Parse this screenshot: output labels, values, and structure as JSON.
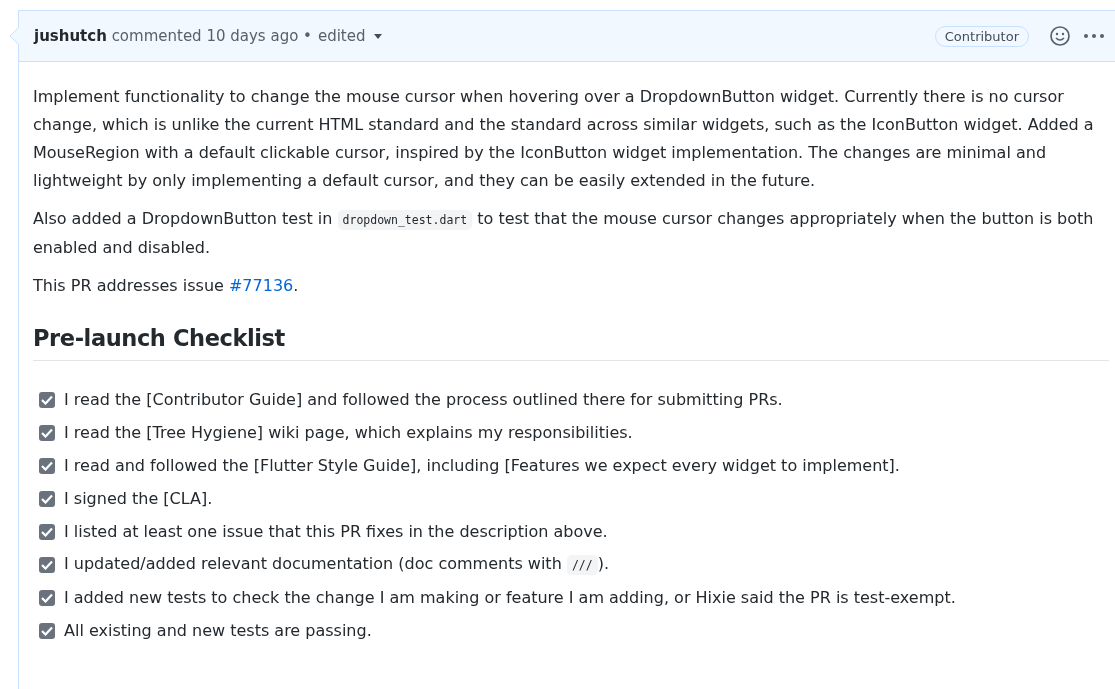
{
  "comment": {
    "author": "jushutch",
    "action": "commented",
    "time": "10 days ago",
    "separator": "•",
    "edited": "edited",
    "badge": "Contributor"
  },
  "paragraphs": [
    [
      {
        "kind": "text",
        "text": "Implement functionality to change the mouse cursor when hovering over a DropdownButton widget. Currently there is no cursor change, which is unlike the current HTML standard and the standard across similar widgets, such as the IconButton widget. Added a MouseRegion with a default clickable cursor, inspired by the IconButton widget implementation. The changes are minimal and lightweight by only implementing a default cursor, and they can be easily extended in the future."
      }
    ],
    [
      {
        "kind": "text",
        "text": "Also added a DropdownButton test in "
      },
      {
        "kind": "code",
        "text": "dropdown_test.dart"
      },
      {
        "kind": "text",
        "text": " to test that the mouse cursor changes appropriately when the button is both enabled and disabled."
      }
    ],
    [
      {
        "kind": "text",
        "text": "This PR addresses issue "
      },
      {
        "kind": "link",
        "text": "#77136"
      },
      {
        "kind": "text",
        "text": "."
      }
    ]
  ],
  "heading": "Pre-launch Checklist",
  "checklist": [
    {
      "checked": true,
      "parts": [
        {
          "kind": "text",
          "text": "I read the [Contributor Guide] and followed the process outlined there for submitting PRs."
        }
      ]
    },
    {
      "checked": true,
      "parts": [
        {
          "kind": "text",
          "text": "I read the [Tree Hygiene] wiki page, which explains my responsibilities."
        }
      ]
    },
    {
      "checked": true,
      "parts": [
        {
          "kind": "text",
          "text": "I read and followed the [Flutter Style Guide], including [Features we expect every widget to implement]."
        }
      ]
    },
    {
      "checked": true,
      "parts": [
        {
          "kind": "text",
          "text": "I signed the [CLA]."
        }
      ]
    },
    {
      "checked": true,
      "parts": [
        {
          "kind": "text",
          "text": "I listed at least one issue that this PR fixes in the description above."
        }
      ]
    },
    {
      "checked": true,
      "parts": [
        {
          "kind": "text",
          "text": "I updated/added relevant documentation (doc comments with "
        },
        {
          "kind": "code",
          "text": "///"
        },
        {
          "kind": "text",
          "text": ")."
        }
      ]
    },
    {
      "checked": true,
      "parts": [
        {
          "kind": "text",
          "text": "I added new tests to check the change I am making or feature I am adding, or Hixie said the PR is test-exempt."
        }
      ]
    },
    {
      "checked": true,
      "parts": [
        {
          "kind": "text",
          "text": "All existing and new tests are passing."
        }
      ]
    }
  ]
}
